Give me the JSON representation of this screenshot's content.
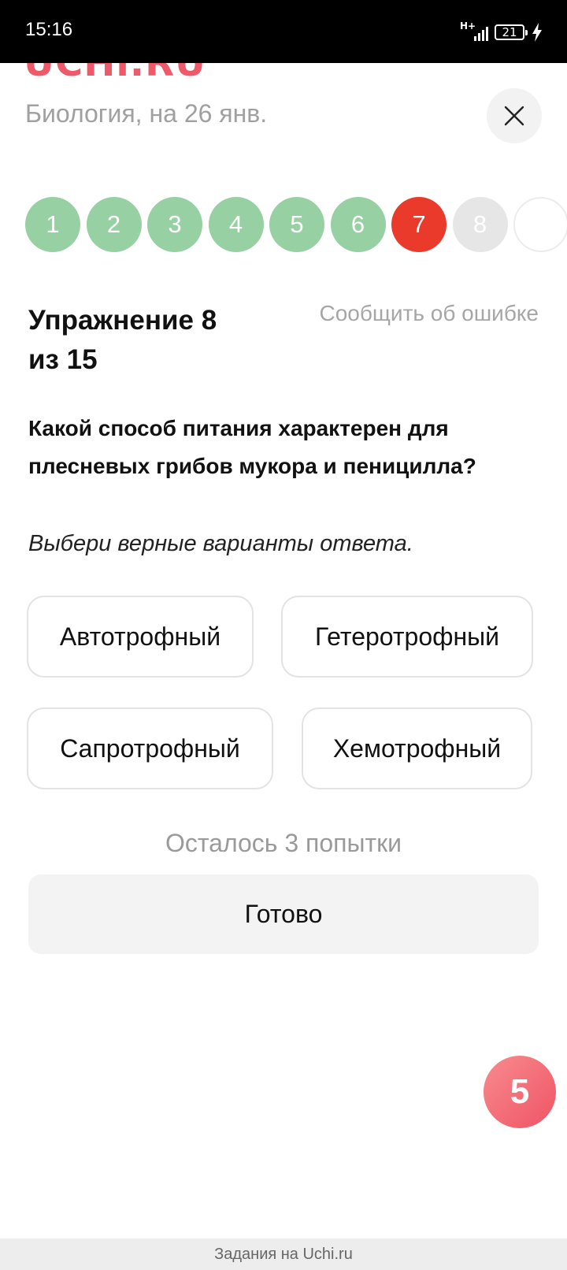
{
  "status_bar": {
    "time": "15:16",
    "network": "H+",
    "battery_level": "21",
    "icons": [
      "signal-icon",
      "battery-icon",
      "charging-bolt-icon"
    ]
  },
  "header": {
    "logo": "UCHi.RU",
    "subject": "Биология, на 26 янв.",
    "close_icon": "close-icon"
  },
  "steps": [
    {
      "label": "1",
      "state": "done"
    },
    {
      "label": "2",
      "state": "done"
    },
    {
      "label": "3",
      "state": "done"
    },
    {
      "label": "4",
      "state": "done"
    },
    {
      "label": "5",
      "state": "done"
    },
    {
      "label": "6",
      "state": "done"
    },
    {
      "label": "7",
      "state": "current"
    },
    {
      "label": "8",
      "state": "pending"
    },
    {
      "label": "",
      "state": "empty"
    }
  ],
  "exercise": {
    "title_line1": "Упражнение 8",
    "title_line2": "из 15",
    "report_label": "Сообщить об ошибке",
    "question": "Какой способ питания характерен для плесневых грибов мукора и пеницилла?",
    "instruction": "Выбери верные варианты ответа.",
    "options": [
      "Автотрофный",
      "Гетеротрофный",
      "Сапротрофный",
      "Хемотрофный"
    ],
    "attempts_left": "Осталось 3 попытки",
    "submit_label": "Готово"
  },
  "bonus_badge": "5",
  "footer": "Задания на Uchi.ru",
  "colors": {
    "brand": "#ef5a6b",
    "step_done": "#97d0a2",
    "step_current": "#ea3a2b",
    "step_pending": "#e6e6e6"
  }
}
